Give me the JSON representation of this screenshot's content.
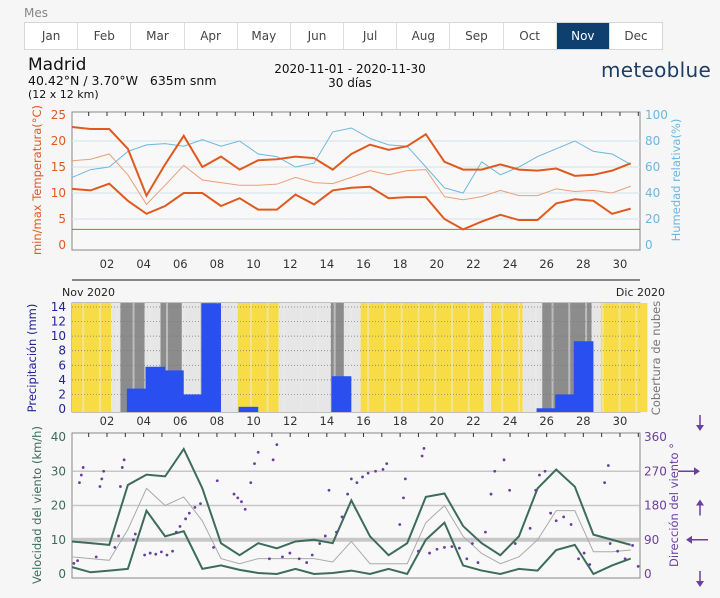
{
  "month_selector": {
    "label": "Mes",
    "months": [
      "Jan",
      "Feb",
      "Mar",
      "Apr",
      "May",
      "Jun",
      "Jul",
      "Aug",
      "Sep",
      "Oct",
      "Nov",
      "Dec"
    ],
    "selected": "Nov",
    "active_color": "#0e3f6e"
  },
  "header": {
    "city": "Madrid",
    "coords": "40.42°N / 3.70°W   635m snm",
    "grid": "(12 x 12 km)",
    "date_range": "2020-11-01 - 2020-11-30",
    "days": "30 días",
    "logo": "meteoblue"
  },
  "chart_data": [
    {
      "type": "line",
      "ylabel": "min/max Temperatura(°C)",
      "ylabel_right": "Humedad relativa(%)",
      "ylim": [
        0,
        25
      ],
      "yticks": [
        "0",
        "5",
        "10",
        "15",
        "20",
        "25"
      ],
      "ylim_right": [
        0,
        100
      ],
      "yticks_right": [
        "0",
        "20",
        "40",
        "60",
        "80",
        "100"
      ],
      "xticks": [
        "02",
        "04",
        "06",
        "08",
        "10",
        "12",
        "14",
        "16",
        "18",
        "20",
        "22",
        "24",
        "26",
        "28",
        "30"
      ],
      "colors": {
        "temp": "#e05a1e",
        "temp_mean": "#e8a07a",
        "humidity": "#6bb7e0"
      },
      "series": {
        "max_temp": [
          22.7,
          22.3,
          22.3,
          18.5,
          9.5,
          15.5,
          21,
          15,
          17,
          14.5,
          16.3,
          16.5,
          17,
          16.7,
          14.5,
          17.5,
          19.3,
          18.3,
          19,
          21.3,
          16,
          14.5,
          14.5,
          15.5,
          14.5,
          14.3,
          14.7,
          13.3,
          13.5,
          14.3,
          15.7
        ],
        "mean_temp": [
          16.2,
          16.5,
          17.5,
          13.5,
          7.8,
          11.5,
          15.3,
          12.5,
          12,
          11.5,
          11.5,
          11.7,
          13,
          12,
          11.8,
          13,
          14.3,
          13.5,
          14.3,
          14.5,
          9.3,
          8.7,
          9.3,
          10.5,
          9.5,
          9.5,
          10.8,
          10.3,
          10.5,
          10,
          11.3
        ],
        "min_temp": [
          10.8,
          10.5,
          11.8,
          8.5,
          6,
          7.5,
          10,
          10,
          7.5,
          9,
          6.8,
          6.8,
          9.7,
          7.8,
          10.5,
          11,
          11.2,
          9,
          9.2,
          9.2,
          5,
          3,
          4.5,
          5.8,
          4.8,
          4.8,
          8,
          8.8,
          8.5,
          6,
          7
        ],
        "humidity": [
          52,
          58,
          60,
          72,
          77,
          78,
          76,
          81,
          76,
          80,
          70,
          68,
          60,
          63,
          87,
          90,
          82,
          77,
          76,
          60,
          44,
          40,
          64,
          54,
          60,
          68,
          74,
          80,
          72,
          70,
          62
        ]
      },
      "reference_line_temp": 3,
      "timeline": {
        "start": "Nov 2020",
        "end": "Dic 2020"
      }
    },
    {
      "type": "bar",
      "ylabel": "Precipitación (mm)",
      "ylabel_right": "Cobertura de nubes",
      "ylim": [
        0,
        14
      ],
      "yticks": [
        "0",
        "2",
        "4",
        "6",
        "8",
        "10",
        "12",
        "14"
      ],
      "xticks": [
        "02",
        "04",
        "06",
        "08",
        "10",
        "12",
        "14",
        "16",
        "18",
        "20",
        "22",
        "24",
        "26",
        "28",
        "30"
      ],
      "colors": {
        "bar": "#2a4ff0",
        "clear": "#f7dc45",
        "partly": "#e6e6e6",
        "cloudy": "#bdbdbd",
        "overcast": "#8c8c8c"
      },
      "precipitation": [
        0,
        0,
        0,
        2.8,
        5.8,
        5.3,
        2,
        14.5,
        0,
        0.3,
        0,
        0,
        0,
        0,
        4.5,
        0,
        0,
        0,
        0,
        0,
        0,
        0,
        0,
        0,
        0,
        0.1,
        2,
        9.3,
        0,
        0,
        0
      ],
      "cloud_cover": [
        {
          "from": 0,
          "to": 2.1,
          "cover": "clear"
        },
        {
          "from": 2.1,
          "to": 2.6,
          "cover": "partly"
        },
        {
          "from": 2.6,
          "to": 3.9,
          "cover": "overcast"
        },
        {
          "from": 3.9,
          "to": 4.75,
          "cover": "partly"
        },
        {
          "from": 4.75,
          "to": 5.9,
          "cover": "overcast"
        },
        {
          "from": 5.9,
          "to": 6.9,
          "cover": "partly"
        },
        {
          "from": 6.9,
          "to": 8.0,
          "cover": "overcast"
        },
        {
          "from": 8.0,
          "to": 8.9,
          "cover": "partly"
        },
        {
          "from": 8.9,
          "to": 11.1,
          "cover": "clear"
        },
        {
          "from": 11.1,
          "to": 13.9,
          "cover": "partly"
        },
        {
          "from": 13.9,
          "to": 14.6,
          "cover": "overcast"
        },
        {
          "from": 14.6,
          "to": 15.5,
          "cover": "partly"
        },
        {
          "from": 15.5,
          "to": 22.1,
          "cover": "clear"
        },
        {
          "from": 22.1,
          "to": 22.5,
          "cover": "partly"
        },
        {
          "from": 22.5,
          "to": 24.2,
          "cover": "clear"
        },
        {
          "from": 24.2,
          "to": 25.25,
          "cover": "partly"
        },
        {
          "from": 25.25,
          "to": 27.9,
          "cover": "overcast"
        },
        {
          "from": 27.9,
          "to": 28.4,
          "cover": "partly"
        },
        {
          "from": 28.4,
          "to": 30.9,
          "cover": "clear"
        }
      ]
    },
    {
      "type": "line",
      "ylabel": "Velocidad del viento (km/h)",
      "ylabel_right": "Dirección del viento °",
      "ylim": [
        0,
        40
      ],
      "yticks": [
        "0",
        "10",
        "20",
        "30",
        "40"
      ],
      "ylim_right": [
        0,
        360
      ],
      "yticks_right": [
        "0",
        "90",
        "180",
        "270",
        "360"
      ],
      "colors": {
        "wind": "#3d6b5c",
        "wind_mean": "#aaaaaa",
        "direction": "#6a3fa0"
      },
      "series": {
        "max_wind": [
          9.5,
          9,
          8.5,
          26,
          29,
          28.5,
          36.5,
          25,
          9,
          5.5,
          9,
          7.5,
          9.5,
          10,
          9,
          21.5,
          11,
          5.5,
          9,
          22.5,
          23.5,
          14,
          9,
          5.5,
          11,
          25,
          30.5,
          25.5,
          11.5,
          10,
          8.5
        ],
        "mean_wind": [
          5,
          4.5,
          4,
          13,
          25,
          20,
          22.5,
          15.5,
          4.5,
          3,
          4.5,
          4.5,
          4.5,
          4.5,
          3.5,
          9.5,
          3,
          3,
          3,
          15,
          20,
          11,
          6,
          3,
          5,
          10,
          18.5,
          18.5,
          6.5,
          6.5,
          7
        ],
        "min_wind": [
          2,
          0.5,
          1,
          1.5,
          18.5,
          11,
          12.5,
          1.5,
          2.5,
          1.2,
          0.3,
          0,
          1.5,
          0,
          0.3,
          1,
          0,
          1.5,
          0,
          10,
          15,
          2.5,
          1,
          0,
          1.5,
          1,
          7,
          8.5,
          0,
          2.5,
          4.5
        ]
      },
      "wind_direction": [
        [
          0.1,
          28
        ],
        [
          0.3,
          35
        ],
        [
          0.5,
          260
        ],
        [
          0.6,
          280
        ],
        [
          0.4,
          240
        ],
        [
          1.3,
          45
        ],
        [
          1.5,
          230
        ],
        [
          1.6,
          250
        ],
        [
          1.7,
          270
        ],
        [
          2.3,
          70
        ],
        [
          2.5,
          100
        ],
        [
          2.6,
          230
        ],
        [
          2.7,
          280
        ],
        [
          2.8,
          300
        ],
        [
          3.3,
          90
        ],
        [
          3.4,
          105
        ],
        [
          3.9,
          50
        ],
        [
          4.2,
          55
        ],
        [
          4.5,
          52
        ],
        [
          4.8,
          58
        ],
        [
          5.1,
          50
        ],
        [
          5.4,
          60
        ],
        [
          5.6,
          110
        ],
        [
          5.8,
          125
        ],
        [
          6.1,
          145
        ],
        [
          6.3,
          160
        ],
        [
          6.6,
          175
        ],
        [
          6.9,
          185
        ],
        [
          7.6,
          70
        ],
        [
          7.8,
          245
        ],
        [
          8.7,
          210
        ],
        [
          8.9,
          200
        ],
        [
          9.1,
          190
        ],
        [
          9.3,
          170
        ],
        [
          9.6,
          240
        ],
        [
          9.8,
          290
        ],
        [
          10.0,
          320
        ],
        [
          10.6,
          40
        ],
        [
          10.8,
          300
        ],
        [
          11.0,
          340
        ],
        [
          11.3,
          45
        ],
        [
          11.7,
          55
        ],
        [
          12.2,
          40
        ],
        [
          12.6,
          30
        ],
        [
          12.9,
          50
        ],
        [
          13.3,
          80
        ],
        [
          13.6,
          100
        ],
        [
          13.8,
          220
        ],
        [
          14.2,
          110
        ],
        [
          14.5,
          150
        ],
        [
          14.8,
          210
        ],
        [
          15.0,
          250
        ],
        [
          15.3,
          240
        ],
        [
          15.6,
          255
        ],
        [
          15.9,
          265
        ],
        [
          16.3,
          270
        ],
        [
          16.7,
          275
        ],
        [
          16.9,
          290
        ],
        [
          17.6,
          130
        ],
        [
          17.8,
          200
        ],
        [
          17.9,
          250
        ],
        [
          18.6,
          60
        ],
        [
          18.8,
          310
        ],
        [
          18.9,
          330
        ],
        [
          19.2,
          55
        ],
        [
          19.6,
          65
        ],
        [
          20.0,
          70
        ],
        [
          20.4,
          72
        ],
        [
          20.8,
          68
        ],
        [
          21.2,
          40
        ],
        [
          21.5,
          80
        ],
        [
          21.8,
          30
        ],
        [
          22.2,
          110
        ],
        [
          22.5,
          210
        ],
        [
          22.7,
          270
        ],
        [
          23.2,
          300
        ],
        [
          23.5,
          220
        ],
        [
          23.8,
          80
        ],
        [
          24.6,
          120
        ],
        [
          24.9,
          220
        ],
        [
          25.1,
          260
        ],
        [
          25.4,
          270
        ],
        [
          25.7,
          160
        ],
        [
          26.0,
          140
        ],
        [
          26.4,
          150
        ],
        [
          26.8,
          130
        ],
        [
          27.2,
          40
        ],
        [
          27.5,
          55
        ],
        [
          27.8,
          25
        ],
        [
          28.6,
          240
        ],
        [
          28.8,
          285
        ],
        [
          28.9,
          80
        ],
        [
          29.3,
          60
        ],
        [
          29.7,
          40
        ],
        [
          30.1,
          75
        ],
        [
          30.4,
          20
        ]
      ]
    }
  ]
}
